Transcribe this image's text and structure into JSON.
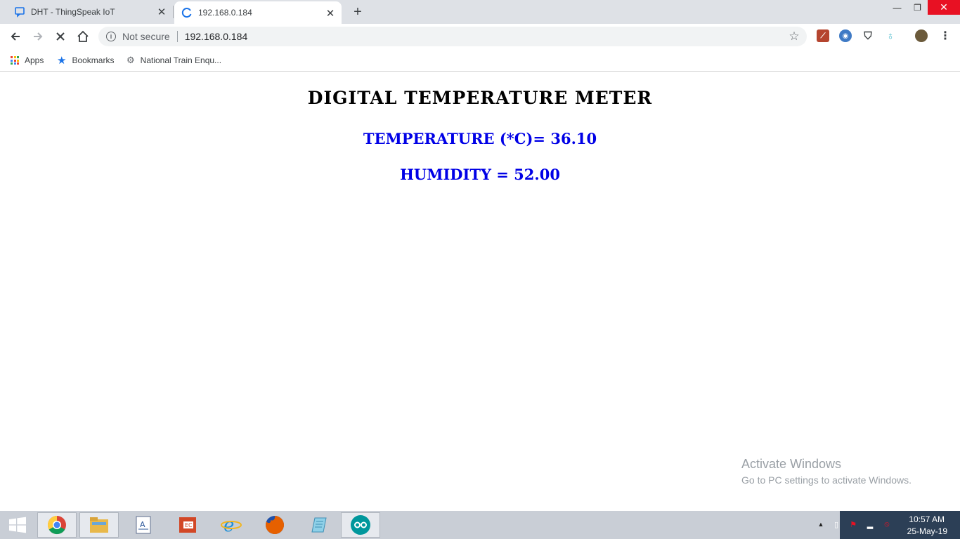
{
  "tabs": [
    {
      "title": "DHT - ThingSpeak IoT",
      "active": false,
      "icon": "chat-icon"
    },
    {
      "title": "192.168.0.184",
      "active": true,
      "icon": "loading-icon"
    }
  ],
  "omnibox": {
    "security": "Not secure",
    "url": "192.168.0.184"
  },
  "bookmarks": [
    {
      "label": "Apps",
      "icon": "apps-grid-icon"
    },
    {
      "label": "Bookmarks",
      "icon": "star-icon"
    },
    {
      "label": "National Train Enqu...",
      "icon": "train-icon"
    }
  ],
  "page": {
    "title": "Digital Temperature Meter",
    "temperature_label": "Temperature (*C)=",
    "temperature_value": "36.10",
    "humidity_label": "Humidity =",
    "humidity_value": "52.00"
  },
  "watermark": {
    "title": "Activate Windows",
    "subtitle": "Go to PC settings to activate Windows."
  },
  "clock": {
    "time": "10:57 AM",
    "date": "25-May-19"
  },
  "colors": {
    "accent_blue": "#0000e6",
    "close_red": "#e81123",
    "tray": "#2c3f56"
  }
}
